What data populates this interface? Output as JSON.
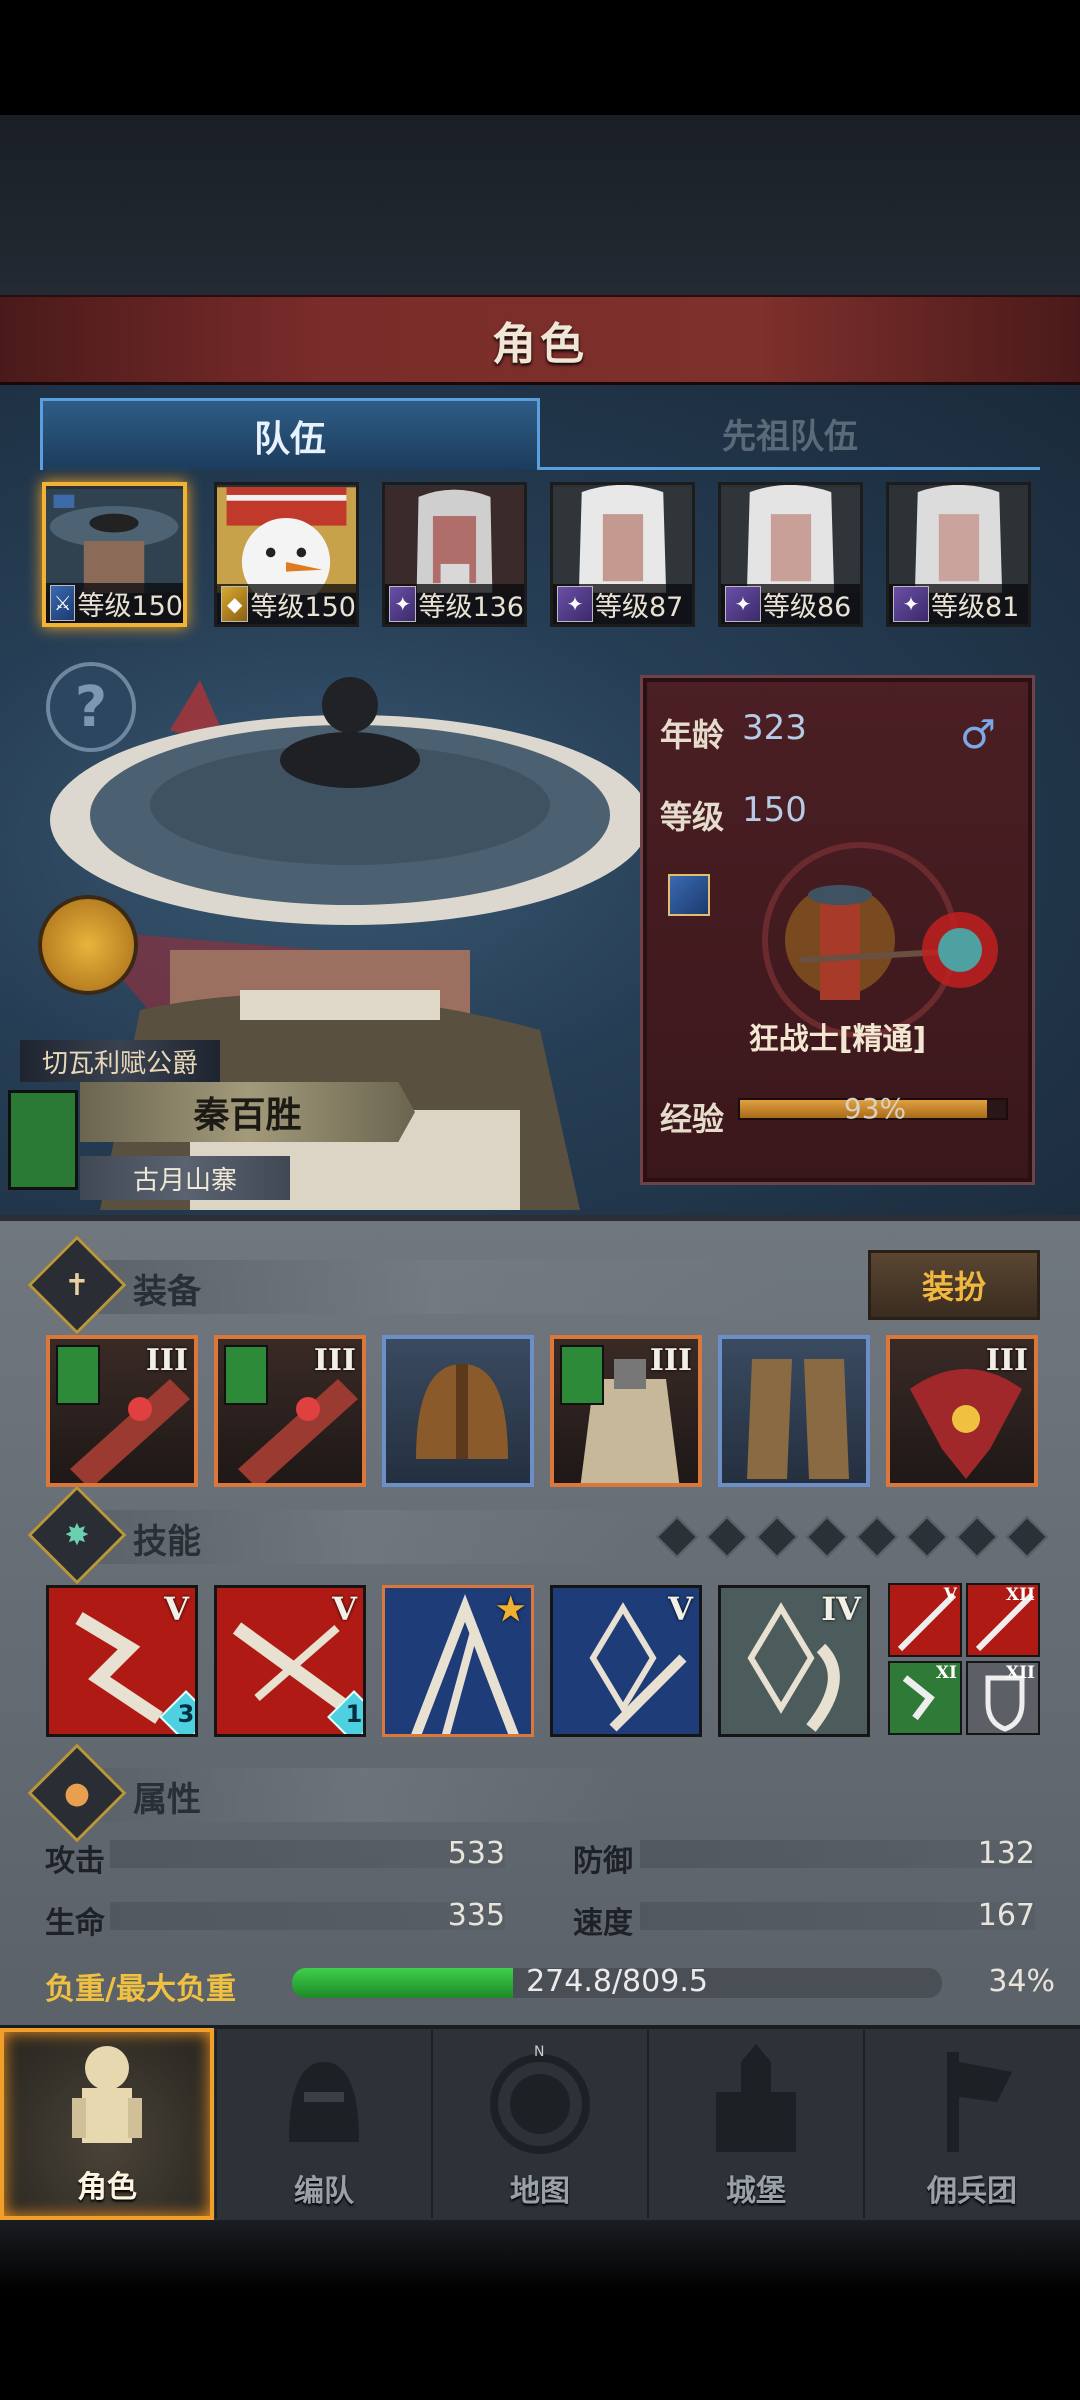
{
  "header": {
    "title": "角色"
  },
  "tabs": {
    "team": "队伍",
    "ancestor": "先祖队伍"
  },
  "portraits": [
    {
      "level": "等级150",
      "selected": true
    },
    {
      "level": "等级150",
      "selected": false
    },
    {
      "level": "等级136",
      "selected": false
    },
    {
      "level": "等级87",
      "selected": false
    },
    {
      "level": "等级86",
      "selected": false
    },
    {
      "level": "等级81",
      "selected": false
    }
  ],
  "hero": {
    "title": "切瓦利赋公爵",
    "name": "秦百胜",
    "village": "古月山寨"
  },
  "info": {
    "age_label": "年龄",
    "age": "323",
    "level_label": "等级",
    "level": "150",
    "gender_icon": "male-icon",
    "class_name": "狂战士[精通]",
    "exp_label": "经验",
    "exp_text": "93%",
    "exp_fraction": 0.93
  },
  "sections": {
    "equipment": "装备",
    "dress_button": "装扮",
    "skills": "技能",
    "attributes": "属性"
  },
  "equipment": [
    {
      "tier": "III",
      "rarity": "orange"
    },
    {
      "tier": "III",
      "rarity": "orange"
    },
    {
      "tier": "",
      "rarity": "blue"
    },
    {
      "tier": "III",
      "rarity": "orange"
    },
    {
      "tier": "",
      "rarity": "blue"
    },
    {
      "tier": "III",
      "rarity": "orange"
    }
  ],
  "skill_slots_total": 8,
  "skills": [
    {
      "tier": "V",
      "gem": "3",
      "color": "#b01a14"
    },
    {
      "tier": "V",
      "gem": "1",
      "color": "#b01a14"
    },
    {
      "tier": "",
      "gem": "",
      "color": "#1e3c78"
    },
    {
      "tier": "V",
      "gem": "",
      "color": "#1e3c78"
    },
    {
      "tier": "IV",
      "gem": "",
      "color": "#4c5c5c"
    }
  ],
  "mini_skills": [
    {
      "tier": "V",
      "color": "#b01a14"
    },
    {
      "tier": "XII",
      "color": "#b01a14"
    },
    {
      "tier": "XI",
      "color": "#2e7a36"
    },
    {
      "tier": "XII",
      "color": "#5c6066"
    }
  ],
  "stats": {
    "attack_label": "攻击",
    "attack": "533",
    "defense_label": "防御",
    "defense": "132",
    "hp_label": "生命",
    "hp": "335",
    "speed_label": "速度",
    "speed": "167",
    "load_label": "负重/最大负重",
    "load": "274.8/809.5",
    "load_pct": "34%",
    "load_fraction": 0.34
  },
  "nav": [
    {
      "label": "角色",
      "active": true
    },
    {
      "label": "编队",
      "active": false
    },
    {
      "label": "地图",
      "active": false
    },
    {
      "label": "城堡",
      "active": false
    },
    {
      "label": "佣兵团",
      "active": false
    }
  ],
  "colors": {
    "accent_gold": "#f2b233",
    "tab_blue": "#5aa0e0",
    "title_red": "#7a2c2a"
  }
}
